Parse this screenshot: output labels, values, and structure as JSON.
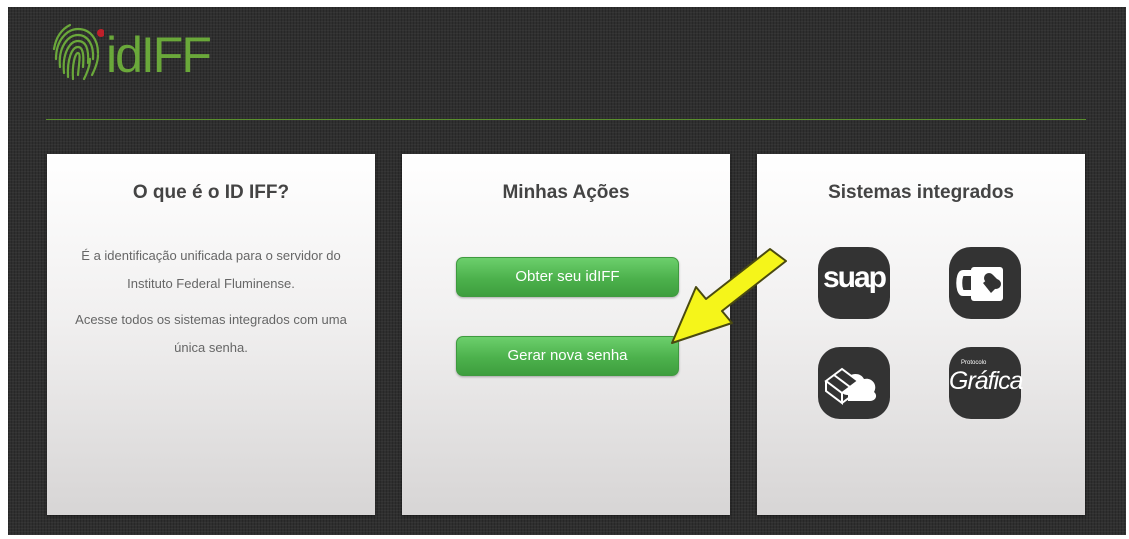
{
  "header": {
    "logo_text": "idIFF",
    "accent": "#6aa83a"
  },
  "cards": {
    "about": {
      "title": "O que é o ID IFF?",
      "paragraph_1": "É a identificação unificada para o servidor do Instituto Federal Fluminense.",
      "paragraph_2": "Acesse todos os sistemas integrados com uma única senha."
    },
    "actions": {
      "title": "Minhas Ações",
      "button_1": "Obter seu idIFF",
      "button_2": "Gerar nova senha"
    },
    "systems": {
      "title": "Sistemas integrados",
      "items": [
        {
          "label": "suap",
          "icon": "suap-icon"
        },
        {
          "label": "",
          "icon": "mug-heart-icon"
        },
        {
          "label": "",
          "icon": "box-cloud-icon"
        },
        {
          "label": "Gráfica",
          "small_label": "Protocolo",
          "icon": "grafica-icon"
        }
      ]
    }
  },
  "annotation": {
    "arrow_color": "#f5f51a",
    "icon": "yellow-arrow-icon"
  },
  "colors": {
    "button_green": "#4cb14c",
    "background": "#2f2f2f"
  }
}
